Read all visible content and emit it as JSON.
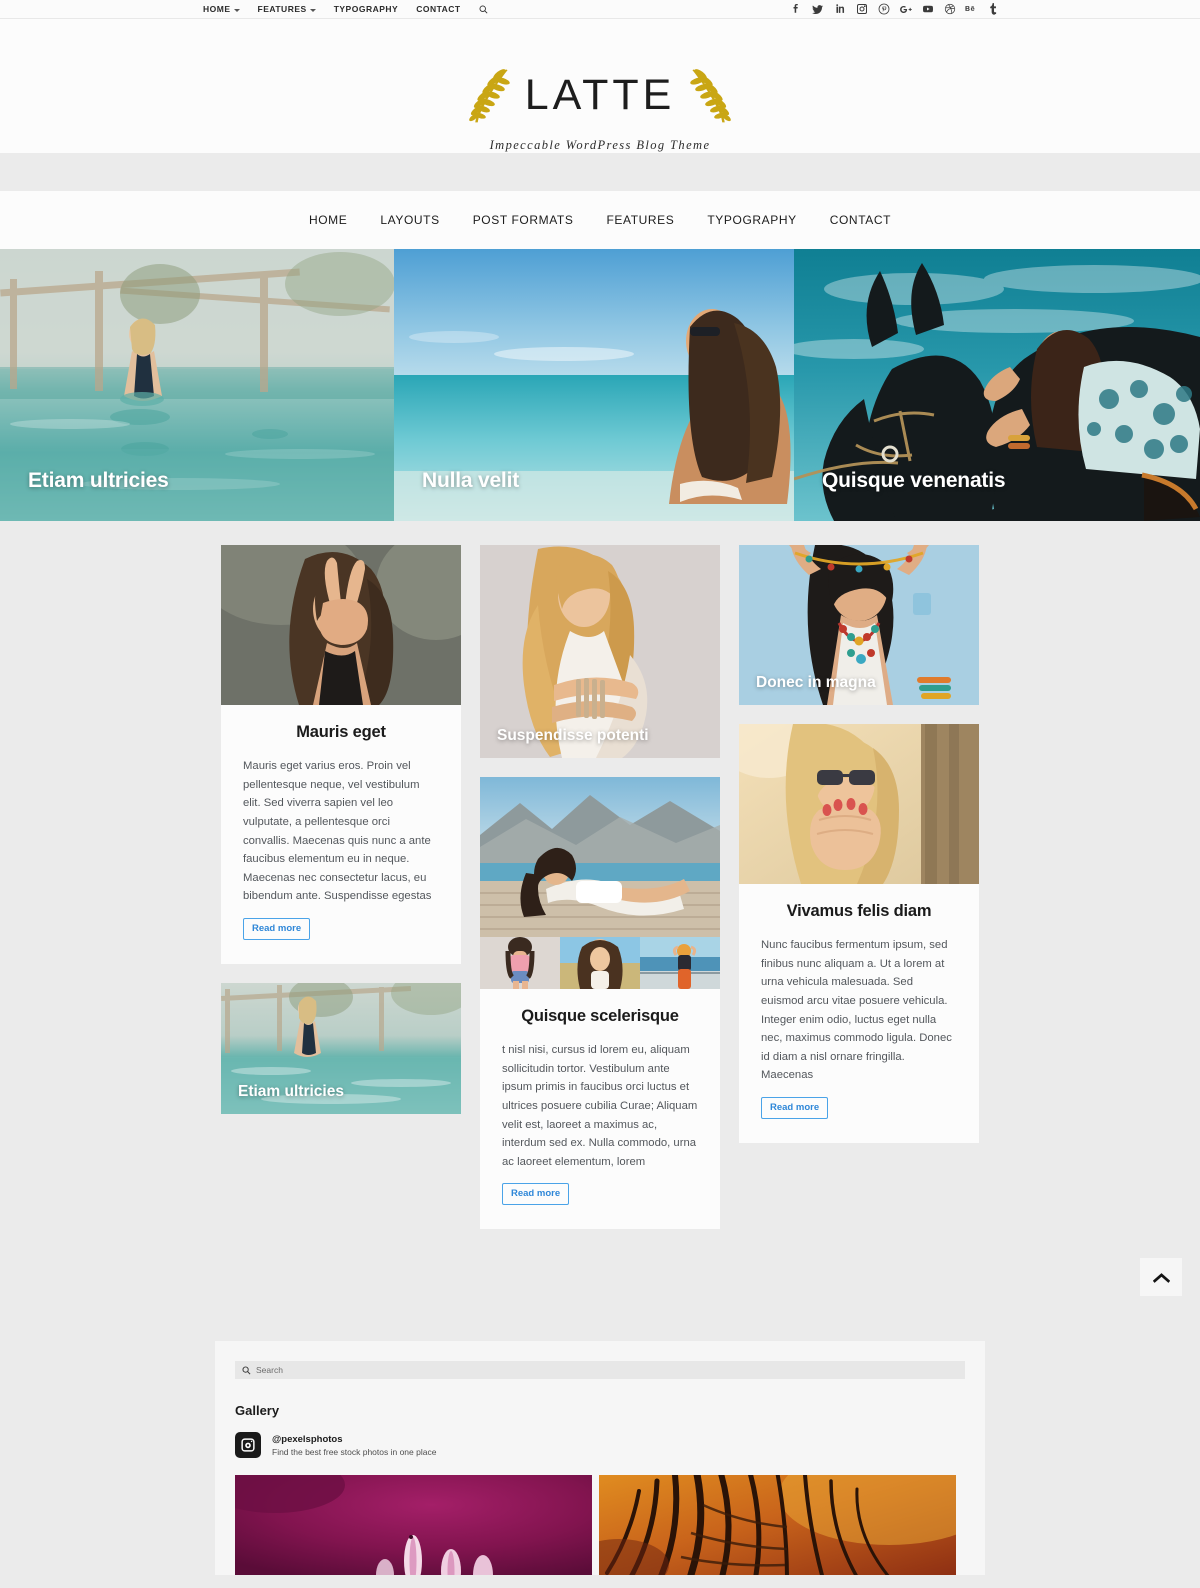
{
  "topbar": {
    "nav": [
      {
        "label": "HOME",
        "has_caret": true
      },
      {
        "label": "FEATURES",
        "has_caret": true
      },
      {
        "label": "TYPOGRAPHY",
        "has_caret": false
      },
      {
        "label": "CONTACT",
        "has_caret": false
      }
    ],
    "search_icon": "search-icon",
    "socials": [
      {
        "name": "facebook-icon",
        "label": "f"
      },
      {
        "name": "twitter-icon",
        "label": "Twitter"
      },
      {
        "name": "linkedin-icon",
        "label": "in"
      },
      {
        "name": "instagram-icon",
        "label": "Instagram"
      },
      {
        "name": "pinterest-icon",
        "label": "Pinterest"
      },
      {
        "name": "google-plus-icon",
        "label": "Google Plus"
      },
      {
        "name": "youtube-icon",
        "label": "YouTube"
      },
      {
        "name": "dribbble-icon",
        "label": "Dribbble"
      },
      {
        "name": "behance-icon",
        "label": "Be"
      },
      {
        "name": "tumblr-icon",
        "label": "t"
      }
    ]
  },
  "brand": {
    "logo_text": "LATTE",
    "tagline": "Impeccable WordPress Blog Theme",
    "laurel_color": "#c9a614"
  },
  "mainnav": {
    "items": [
      "HOME",
      "LAYOUTS",
      "POST FORMATS",
      "FEATURES",
      "TYPOGRAPHY",
      "CONTACT"
    ]
  },
  "hero": {
    "slides": [
      {
        "title": "Etiam ultricies",
        "image": "woman-in-infinity-pool"
      },
      {
        "title": "Nulla velit",
        "image": "woman-at-turquoise-beach"
      },
      {
        "title": "Quisque venenatis",
        "image": "woman-with-black-horse"
      }
    ]
  },
  "posts": {
    "mauris": {
      "title": "Mauris eget",
      "image": "woman-peace-sign-portrait",
      "excerpt": "Mauris eget varius eros. Proin vel pellentesque neque, vel vestibulum elit. Sed viverra sapien vel leo vulputate, a pellentesque orci convallis. Maecenas quis nunc a ante faucibus elementum eu in neque. Maecenas nec consectetur lacus, eu bibendum ante. Suspendisse egestas",
      "read_more": "Read more"
    },
    "etiam": {
      "title": "Etiam ultricies",
      "image": "woman-in-infinity-pool"
    },
    "suspendisse": {
      "title": "Suspendisse potenti",
      "image": "blonde-woman-white-dress"
    },
    "quisque": {
      "title": "Quisque scelerisque",
      "image": "woman-lying-on-beach-deck",
      "thumbnails": [
        "woman-pink-top",
        "woman-in-field",
        "woman-by-sea-railing"
      ],
      "excerpt": "t nisl nisi, cursus id lorem eu, aliquam sollicitudin tortor. Vestibulum ante ipsum primis in faucibus orci luctus et ultrices posuere cubilia Curae; Aliquam velit est, laoreet a maximus ac, interdum sed ex. Nulla commodo, urna ac laoreet elementum, lorem",
      "read_more": "Read more"
    },
    "donec": {
      "title": "Donec in magna",
      "image": "woman-with-beads-necklace"
    },
    "vivamus": {
      "title": "Vivamus felis diam",
      "image": "blonde-woman-sunglasses-hands",
      "excerpt": "Nunc faucibus fermentum ipsum, sed finibus nunc aliquam a. Ut a lorem at urna vehicula malesuada. Sed euismod arcu vitae posuere vehicula. Integer enim odio, luctus eget nulla nec, maximus commodo ligula. Donec id diam a nisl ornare fringilla. Maecenas",
      "read_more": "Read more"
    }
  },
  "scroll_top": {
    "icon": "chevron-up-icon"
  },
  "footer": {
    "search": {
      "placeholder": "Search",
      "value": "",
      "icon": "search-icon"
    },
    "gallery_heading": "Gallery",
    "instagram": {
      "handle": "@pexelsphotos",
      "subtitle": "Find the best free stock photos in one place",
      "icon": "instagram-icon"
    },
    "images": [
      "magenta-flower-macro",
      "orange-feather-macro"
    ]
  },
  "colors": {
    "page_bg": "#ebebeb",
    "card_bg": "#fcfcfc",
    "accent_link": "#2f87d8",
    "accent_border": "#4aa3e8",
    "text_dark": "#1b1b1b",
    "text_body": "#53575c",
    "laurel_gold": "#c9a614"
  }
}
